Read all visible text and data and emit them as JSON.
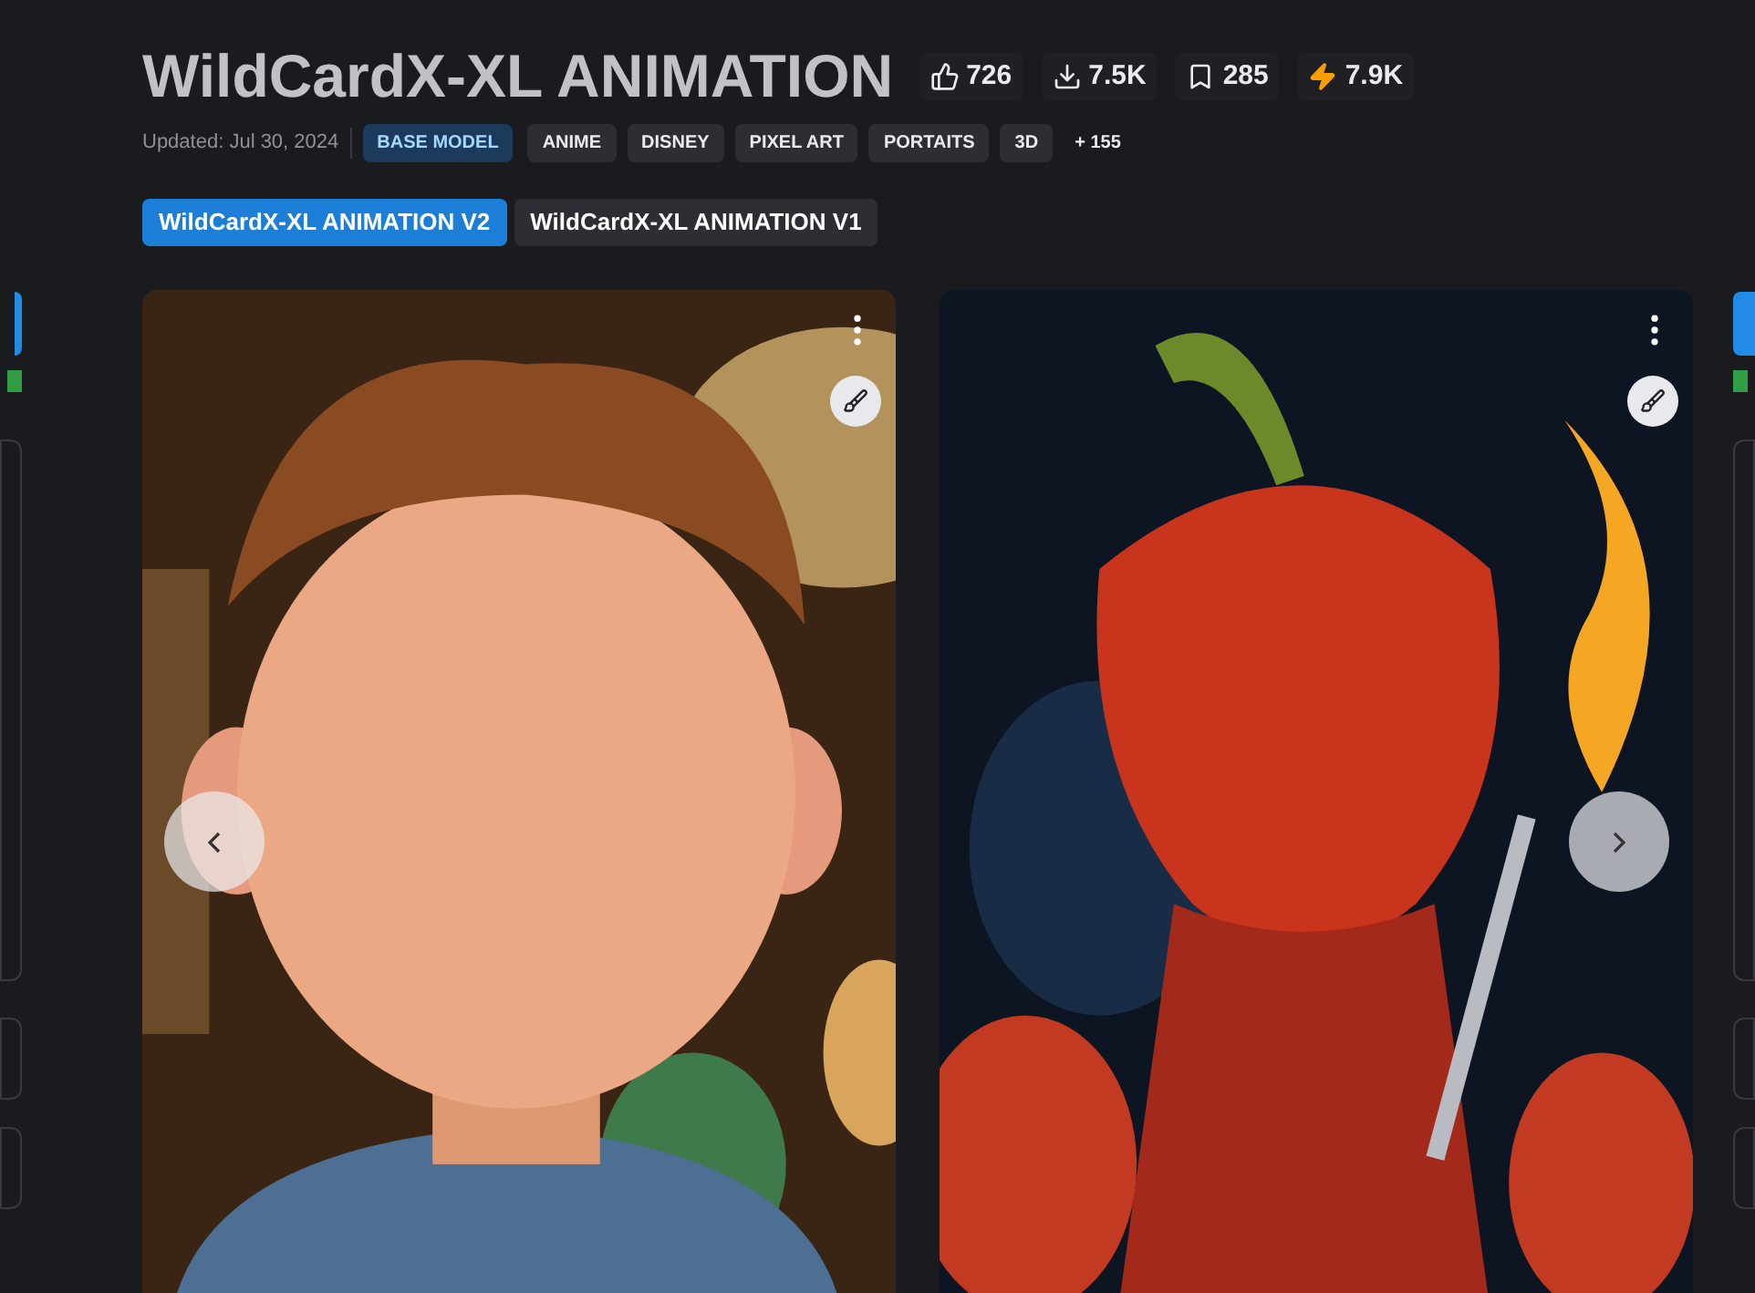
{
  "title": "WildCardX-XL ANIMATION",
  "stats": [
    {
      "kind": "likes",
      "value": "726"
    },
    {
      "kind": "downloads",
      "value": "7.5K"
    },
    {
      "kind": "bookmarks",
      "value": "285"
    },
    {
      "kind": "buzz",
      "value": "7.9K"
    }
  ],
  "updated": "Updated: Jul 30, 2024",
  "type_badge": "BASE MODEL",
  "tags": [
    "ANIME",
    "DISNEY",
    "PIXEL ART",
    "PORTAITS",
    "3D"
  ],
  "more_tags": "+ 155",
  "versions": [
    {
      "label": "WildCardX-XL ANIMATION V2",
      "selected": true
    },
    {
      "label": "WildCardX-XL ANIMATION V1",
      "selected": false
    }
  ]
}
